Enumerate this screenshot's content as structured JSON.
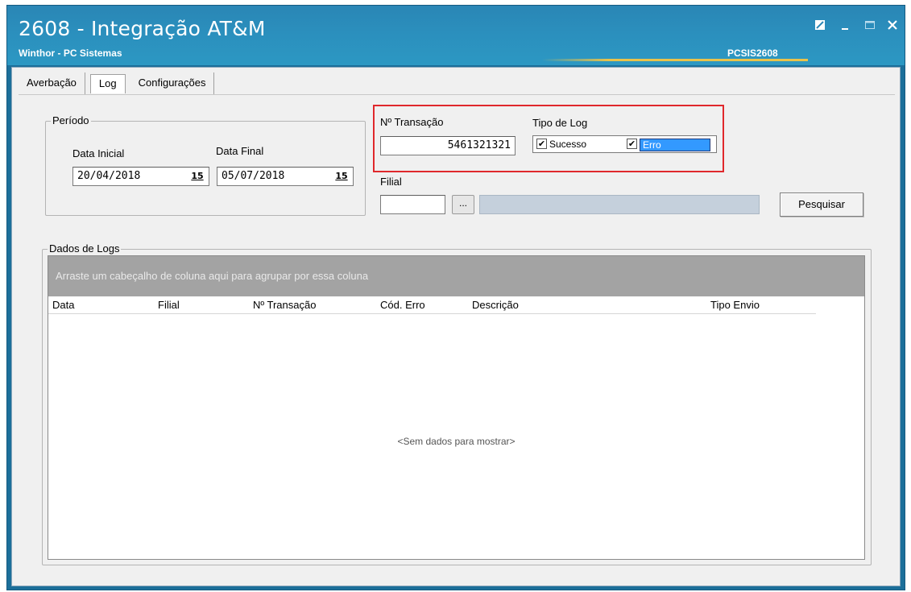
{
  "window": {
    "title": "2608 - Integração AT&M",
    "subtitle": "Winthor - PC Sistemas",
    "program_code": "PCSIS2608",
    "controls": {
      "restore_icon": "restore-icon",
      "minimize_icon": "minimize-icon",
      "maximize_icon": "maximize-icon",
      "close_icon": "close-icon"
    }
  },
  "tabs": [
    {
      "label": "Averbação"
    },
    {
      "label": "Log",
      "active": true
    },
    {
      "label": "Configurações"
    }
  ],
  "periodo": {
    "legend": "Período",
    "data_inicial_label": "Data Inicial",
    "data_inicial_value": "20/04/2018",
    "data_final_label": "Data Final",
    "data_final_value": "05/07/2018",
    "calendar_glyph": "15"
  },
  "transacao": {
    "label": "Nº Transação",
    "value": "5461321321"
  },
  "tipo_log": {
    "label": "Tipo de Log",
    "sucesso_label": "Sucesso",
    "sucesso_checked": true,
    "erro_label": "Erro",
    "erro_checked": true
  },
  "filial": {
    "label": "Filial",
    "value": "",
    "lookup_label": "...",
    "description": ""
  },
  "search_button_label": "Pesquisar",
  "dados_logs": {
    "legend": "Dados de Logs",
    "group_panel_text": "Arraste um cabeçalho de coluna aqui para agrupar por essa coluna",
    "columns": [
      "Data",
      "Filial",
      "Nº Transação",
      "Cód. Erro",
      "Descrição",
      "Tipo Envio"
    ],
    "empty_text": "<Sem dados para mostrar>"
  },
  "colors": {
    "title_bar": "#2a86b5",
    "highlight_border": "#e0282c",
    "selection": "#3399ff"
  }
}
